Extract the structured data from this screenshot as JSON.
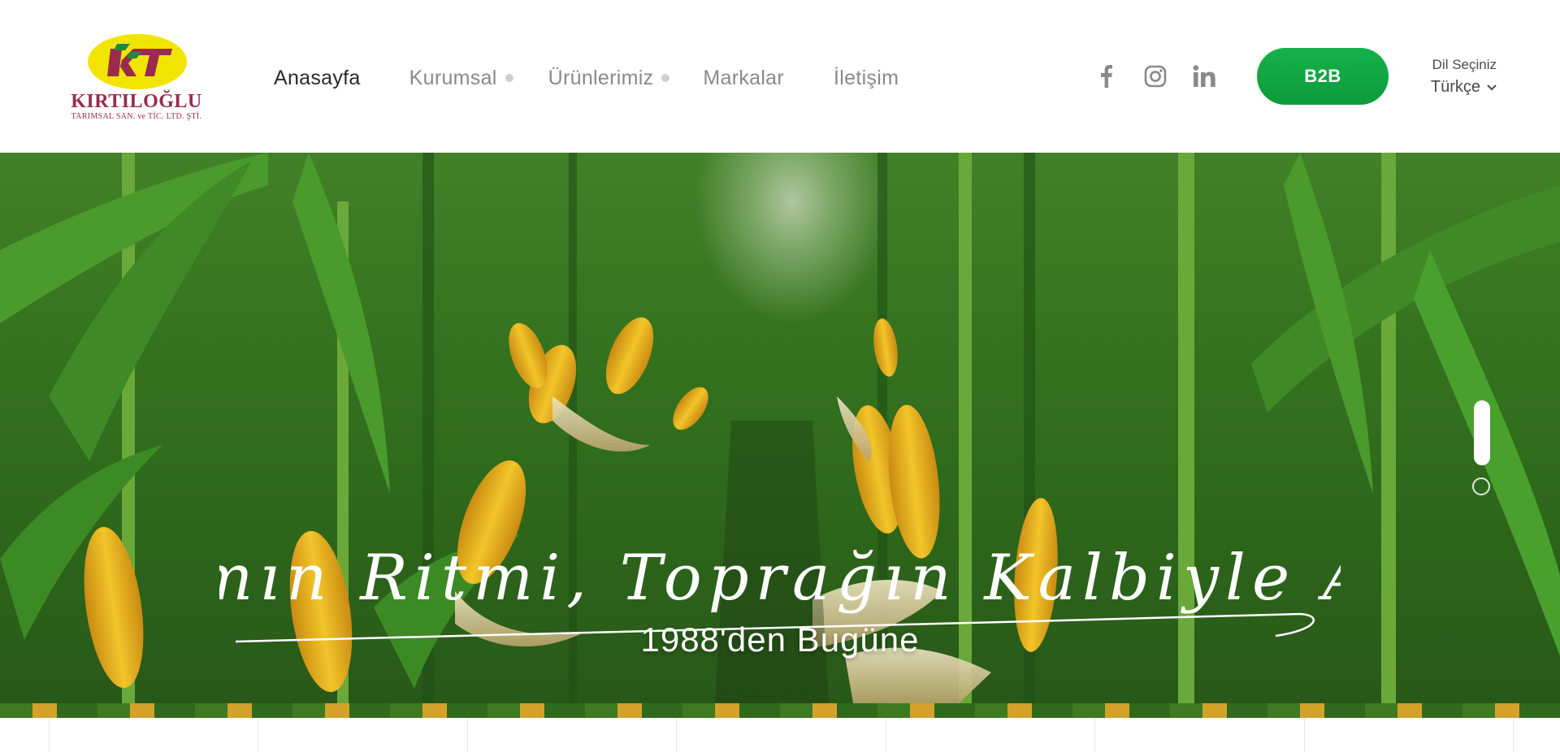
{
  "header": {
    "logo": {
      "name": "KIRTILOĞLU",
      "subtitle": "TARIMSAL SAN. ve TİC. LTD. ŞTİ.",
      "mark": "KT",
      "colors": {
        "oval": "#f1e500",
        "text": "#9b2a4e",
        "mark_green": "#1f8a3a"
      }
    },
    "nav": {
      "items": [
        {
          "label": "Anasayfa",
          "active": true,
          "has_submenu": false
        },
        {
          "label": "Kurumsal",
          "active": false,
          "has_submenu": true
        },
        {
          "label": "Ürünlerimiz",
          "active": false,
          "has_submenu": true
        },
        {
          "label": "Markalar",
          "active": false,
          "has_submenu": false
        },
        {
          "label": "İletişim",
          "active": false,
          "has_submenu": false
        }
      ]
    },
    "social": [
      {
        "icon": "facebook-icon"
      },
      {
        "icon": "instagram-icon"
      },
      {
        "icon": "linkedin-icon"
      }
    ],
    "b2b_button": {
      "label": "B2B",
      "color": "#12a845"
    },
    "language": {
      "label": "Dil Seçiniz",
      "selected": "Türkçe",
      "icon": "chevron-down-icon"
    }
  },
  "hero": {
    "slogan": "Tarımın Ritmi, Toprağın Kalbiyle Atar!",
    "since": "1988'den Bugüne",
    "slider": {
      "current_slide": 1,
      "total_slides": 2
    }
  }
}
